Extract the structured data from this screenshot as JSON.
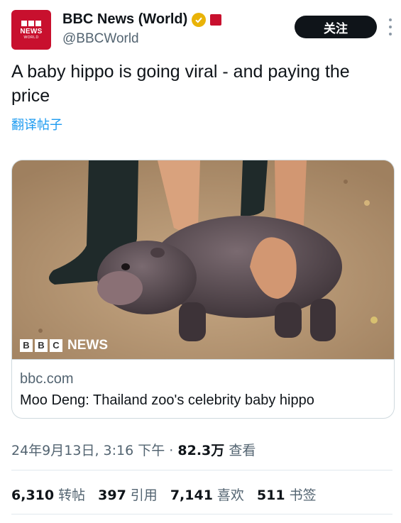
{
  "colors": {
    "brand": "#c8102e",
    "link": "#1d9bf0",
    "verified": "#e9b308"
  },
  "account": {
    "avatar_line1": "BBC",
    "avatar_line2": "NEWS",
    "avatar_line3": "WORLD",
    "display_name": "BBC News (World)",
    "handle": "@BBCWorld",
    "follow_label": "关注",
    "verified_icon": "verified-badge-icon",
    "more_icon": "more-vertical-icon"
  },
  "tweet": {
    "text": "A baby hippo is going viral - and paying the price",
    "translate_link": "翻译帖子"
  },
  "card": {
    "image_logo_letters": [
      "B",
      "B",
      "C"
    ],
    "image_logo_text": "NEWS",
    "domain": "bbc.com",
    "title": "Moo Deng: Thailand zoo's celebrity baby hippo"
  },
  "meta": {
    "timestamp": "24年9月13日, 3:16 下午",
    "separator": "·",
    "views_count": "82.3万",
    "views_label": "查看"
  },
  "stats": [
    {
      "count": "6,310",
      "label": "转帖"
    },
    {
      "count": "397",
      "label": "引用"
    },
    {
      "count": "7,141",
      "label": "喜欢"
    },
    {
      "count": "511",
      "label": "书签"
    }
  ]
}
